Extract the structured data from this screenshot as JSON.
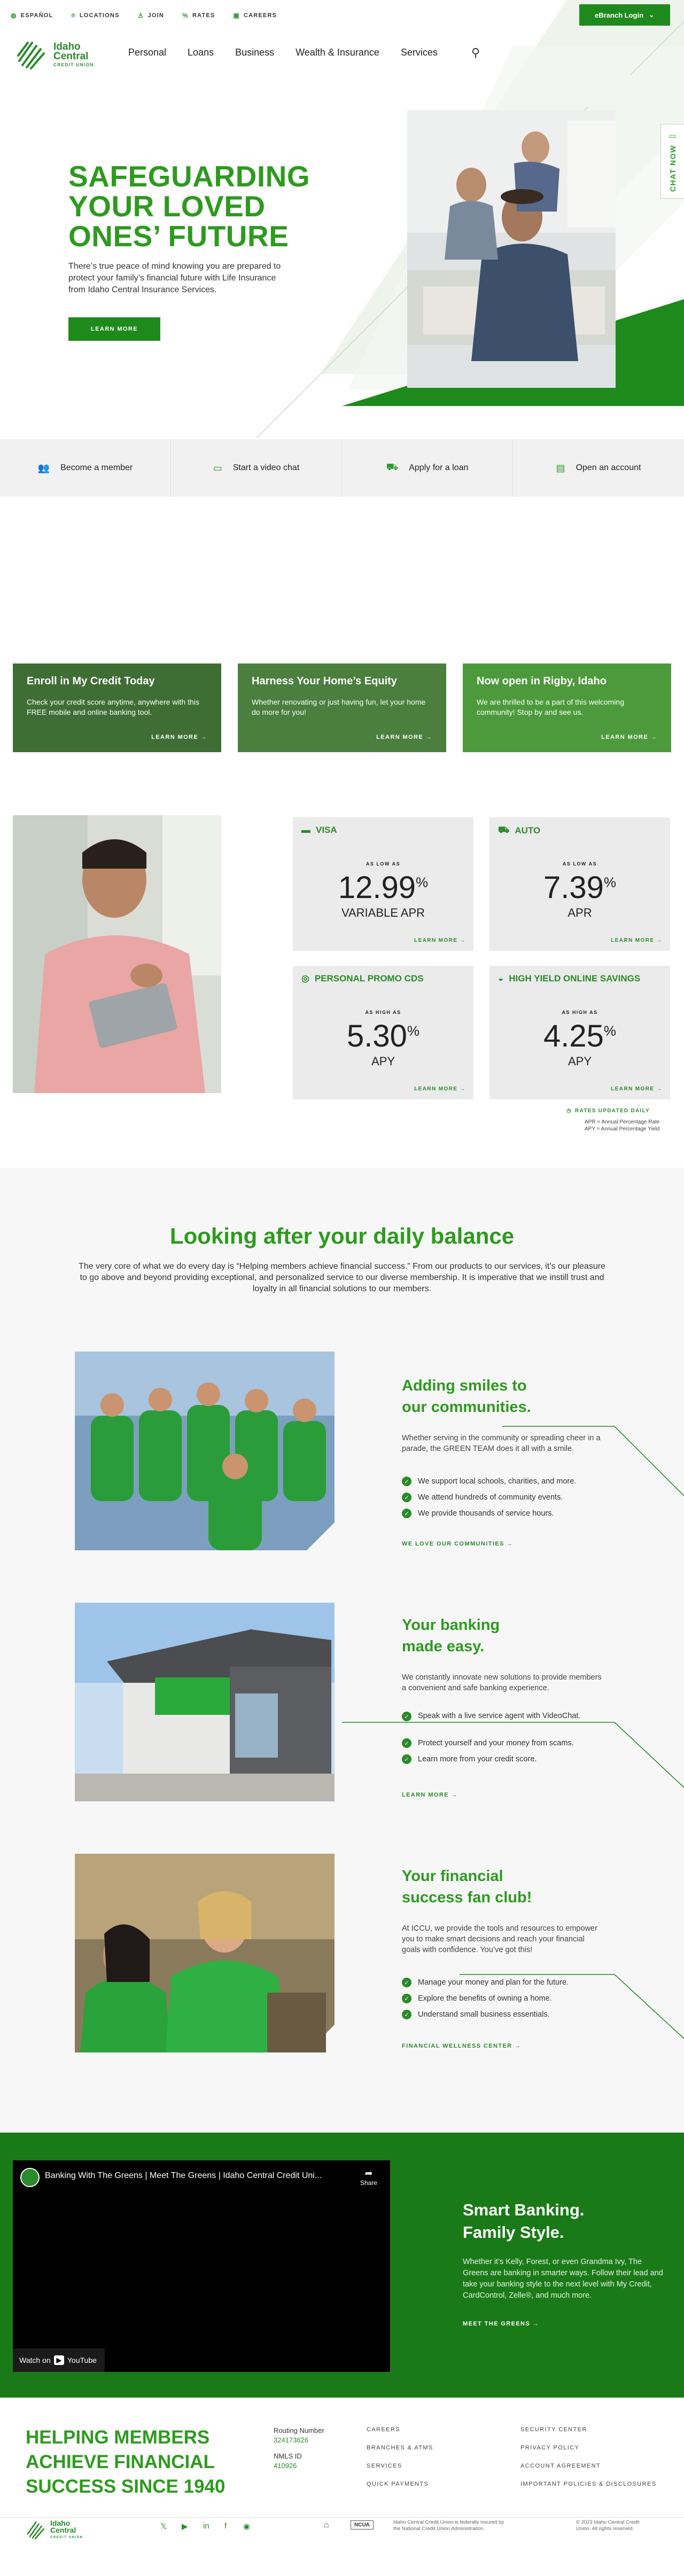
{
  "utility_nav": [
    {
      "label": "ESPAÑOL",
      "icon": "globe-icon"
    },
    {
      "label": "LOCATIONS",
      "icon": "pin-icon"
    },
    {
      "label": "JOIN",
      "icon": "person-icon"
    },
    {
      "label": "RATES",
      "icon": "percent-icon"
    },
    {
      "label": "CAREERS",
      "icon": "briefcase-icon"
    }
  ],
  "ebranch": {
    "label": "eBranch Login",
    "icon": "chevron-down-icon"
  },
  "brand": {
    "line1": "Idaho",
    "line2": "Central",
    "tagline": "CREDIT UNION",
    "color": "#2e9a1f"
  },
  "main_nav": [
    "Personal",
    "Loans",
    "Business",
    "Wealth & Insurance",
    "Services"
  ],
  "hero": {
    "title": [
      "SAFEGUARDING",
      "YOUR LOVED",
      "ONES’ FUTURE"
    ],
    "subtitle": "There’s true peace of mind knowing you are prepared to protect your family’s financial future with Life Insurance from Idaho Central Insurance Services.",
    "button": "LEARN MORE"
  },
  "chat_now": "CHAT NOW",
  "quick_actions": [
    {
      "label": "Become a member",
      "icon": "people-icon"
    },
    {
      "label": "Start a video chat",
      "icon": "video-chat-icon"
    },
    {
      "label": "Apply for a loan",
      "icon": "car-icon"
    },
    {
      "label": "Open an account",
      "icon": "id-card-icon"
    }
  ],
  "promos": [
    {
      "title": "Enroll in My Credit Today",
      "text": "Check your credit score anytime, anywhere with this FREE mobile and online banking tool.",
      "link": "LEARN MORE"
    },
    {
      "title": "Harness Your Home’s Equity",
      "text": "Whether renovating or just having fun, let your home do more for you!",
      "link": "LEARN MORE"
    },
    {
      "title": "Now open in Rigby, Idaho",
      "text": "We are thrilled to be a part of this welcoming community! Stop by and see us.",
      "link": "LEARN MORE"
    }
  ],
  "rates": [
    {
      "name": "VISA",
      "icon": "credit-card-icon",
      "qualifier": "AS LOW AS",
      "value": "12.99",
      "unit": "VARIABLE APR",
      "link": "LEARN MORE"
    },
    {
      "name": "AUTO",
      "icon": "car-icon",
      "qualifier": "AS LOW AS",
      "value": "7.39",
      "unit": "APR",
      "link": "LEARN MORE"
    },
    {
      "name": "PERSONAL PROMO CDS",
      "icon": "coins-icon",
      "qualifier": "AS HIGH AS",
      "value": "5.30",
      "unit": "APY",
      "link": "LEARN MORE"
    },
    {
      "name": "HIGH YIELD ONLINE SAVINGS",
      "icon": "piggy-bank-icon",
      "qualifier": "AS HIGH AS",
      "value": "4.25",
      "unit": "APY",
      "link": "LEARN MORE"
    }
  ],
  "rates_footer": {
    "updated": "RATES UPDATED DAILY",
    "apr": "APR = Annual Percentage Rate",
    "apy": "APY = Annual Percentage Yield"
  },
  "daily": {
    "title": "Looking after your daily balance",
    "intro": "The very core of what we do every day is “Helping members achieve financial success.” From our products to our services, it’s our pleasure to go above and beyond providing exceptional, and personalized service to our diverse membership. It is imperative that we instill trust and loyalty in all financial solutions to our members."
  },
  "features": [
    {
      "title": [
        "Adding smiles to",
        "our communities."
      ],
      "text": "Whether serving in the community or spreading cheer in a parade, the GREEN TEAM does it all with a smile.",
      "bullets": [
        "We support local schools, charities, and more.",
        "We attend hundreds of community events.",
        "We provide thousands of service hours."
      ],
      "link": "WE LOVE OUR COMMUNITIES"
    },
    {
      "title": [
        "Your banking",
        "made easy."
      ],
      "text": "We constantly innovate new solutions to provide members a convenient and safe banking experience.",
      "bullets": [
        "Speak with a live service agent with VideoChat.",
        "Protect yourself and your money from scams.",
        "Learn more from your credit score."
      ],
      "link": "LEARN MORE"
    },
    {
      "title": [
        "Your financial",
        "success fan club!"
      ],
      "text": "At ICCU, we provide the tools and resources to empower you to make smart decisions and reach your financial goals with confidence. You’ve got this!",
      "bullets": [
        "Manage your money and plan for the future.",
        "Explore the benefits of owning a home.",
        "Understand small business essentials."
      ],
      "link": "FINANCIAL WELLNESS CENTER"
    }
  ],
  "video": {
    "title": "Banking With The Greens | Meet The Greens | Idaho Central Credit Uni...",
    "share": "Share",
    "watch_on": "Watch on",
    "youtube": "YouTube",
    "heading": [
      "Smart Banking.",
      "Family Style."
    ],
    "text": "Whether it’s Kelly, Forest, or even Grandma Ivy, The Greens are banking in smarter ways. Follow their lead and take your banking style to the next level with My Credit, CardControl, Zelle®, and much more.",
    "link": "MEET THE GREENS"
  },
  "footer": {
    "title": [
      "HELPING MEMBERS",
      "ACHIEVE FINANCIAL",
      "SUCCESS SINCE 1940"
    ],
    "routing_label": "Routing Number",
    "routing": "324173626",
    "nmls_label": "NMLS ID",
    "nmls": "410926",
    "col1": [
      "CAREERS",
      "BRANCHES & ATMS",
      "SERVICES",
      "QUICK PAYMENTS"
    ],
    "col2": [
      "SECURITY CENTER",
      "PRIVACY POLICY",
      "ACCOUNT AGREEMENT",
      "IMPORTANT POLICIES & DISCLOSURES"
    ],
    "ncua": "NCUA",
    "insured": "Idaho Central Credit Union is federally insured by the National Credit Union Administration.",
    "copyright": "© 2023 Idaho Central Credit Union. All rights reserved."
  }
}
